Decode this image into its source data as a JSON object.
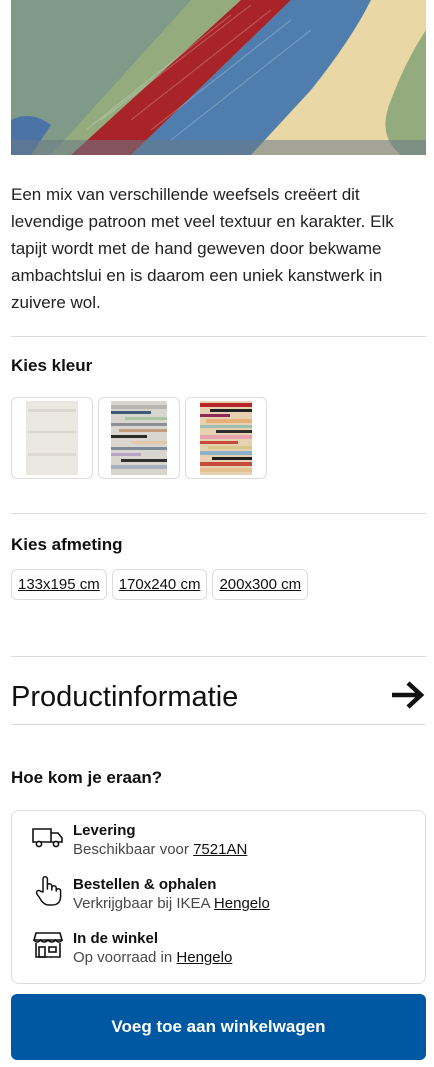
{
  "product": {
    "description": "Een mix van verschillende weefsels creëert dit levendige patroon met veel textuur en karakter. Elk tapijt wordt met de hand geweven door bekwame ambachtslui en is daarom een uniek kanstwerk in zuivere wol."
  },
  "colors": {
    "title": "Kies kleur",
    "options": [
      "color-option-light",
      "color-option-multicolor-grey",
      "color-option-multicolor-red"
    ]
  },
  "sizes": {
    "title": "Kies afmeting",
    "options": [
      "133x195 cm",
      "170x240 cm",
      "200x300 cm"
    ]
  },
  "product_info": {
    "title": "Productinformatie",
    "icon": "arrow-right-icon"
  },
  "delivery": {
    "title": "Hoe kom je eraan?",
    "items": [
      {
        "icon": "truck-icon",
        "title": "Levering",
        "text": "Beschikbaar voor",
        "link": "7521AN"
      },
      {
        "icon": "hand-pointer-icon",
        "title": "Bestellen & ophalen",
        "text": "Verkrijgbaar bij IKEA",
        "link": "Hengelo"
      },
      {
        "icon": "store-icon",
        "title": "In de winkel",
        "text": "Op voorraad in",
        "link": "Hengelo"
      }
    ]
  },
  "cart": {
    "button_label": "Voeg toe aan winkelwagen"
  },
  "theme": {
    "accent": "#0058a3"
  }
}
